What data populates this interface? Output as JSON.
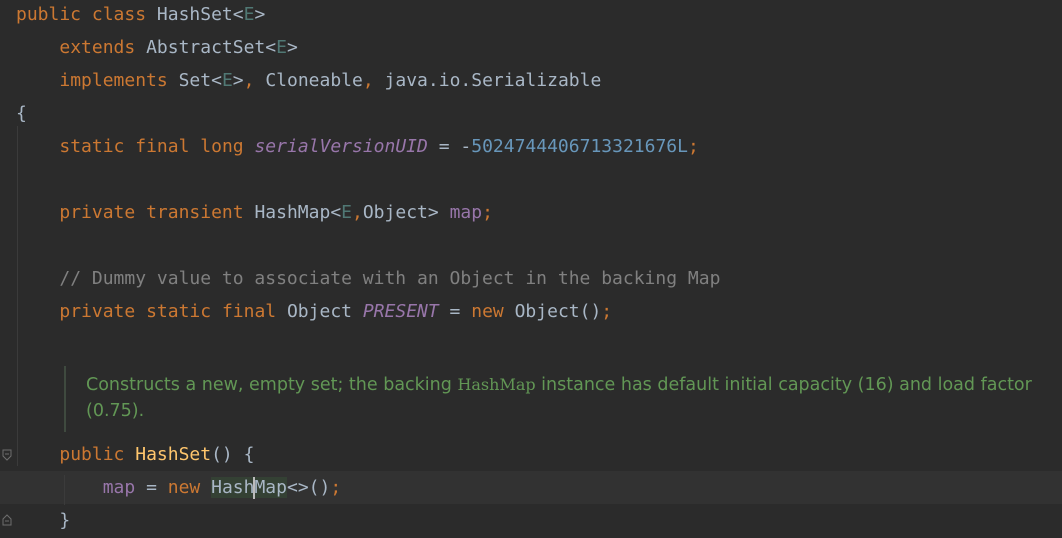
{
  "code": {
    "l1": {
      "kw1": "public",
      "kw2": "class",
      "name": "HashSet",
      "lt": "<",
      "gen": "E",
      "gt": ">"
    },
    "l2": {
      "kw": "extends",
      "type": "AbstractSet",
      "lt": "<",
      "gen": "E",
      "gt": ">"
    },
    "l3": {
      "kw": "implements",
      "t1": "Set",
      "lt": "<",
      "gen": "E",
      "gt": ">",
      "comma1": ",",
      "t2": "Cloneable",
      "comma2": ",",
      "t3": "java.io.Serializable"
    },
    "l4": {
      "brace": "{"
    },
    "l5": {
      "kw1": "static",
      "kw2": "final",
      "kw3": "long",
      "field": "serialVersionUID",
      "eq": "=",
      "minus": "-",
      "num": "5024744406713321676L",
      "semi": ";"
    },
    "l6": {
      "kw1": "private",
      "kw2": "transient",
      "type": "HashMap",
      "lt": "<",
      "gen": "E",
      "comma": ",",
      "t2": "Object",
      "gt": ">",
      "field": "map",
      "semi": ";"
    },
    "l7": {
      "comment": "// Dummy value to associate with an Object in the backing Map"
    },
    "l8": {
      "kw1": "private",
      "kw2": "static",
      "kw3": "final",
      "type": "Object",
      "field": "PRESENT",
      "eq": "=",
      "kw4": "new",
      "ctor": "Object()",
      "semi": ";"
    },
    "doc": {
      "part1": "Constructs a new, empty set; the backing ",
      "code": "HashMap",
      "part2": " instance has default initial capacity (16) and load factor (0.75)."
    },
    "l9": {
      "kw": "public",
      "name": "HashSet",
      "rest": "() {"
    },
    "l10": {
      "field": "map",
      "eq": "=",
      "kw": "new",
      "t1": "Hash",
      "t2": "Map",
      "rest": "<>()",
      "semi": ";"
    },
    "l11": {
      "brace": "}"
    }
  }
}
